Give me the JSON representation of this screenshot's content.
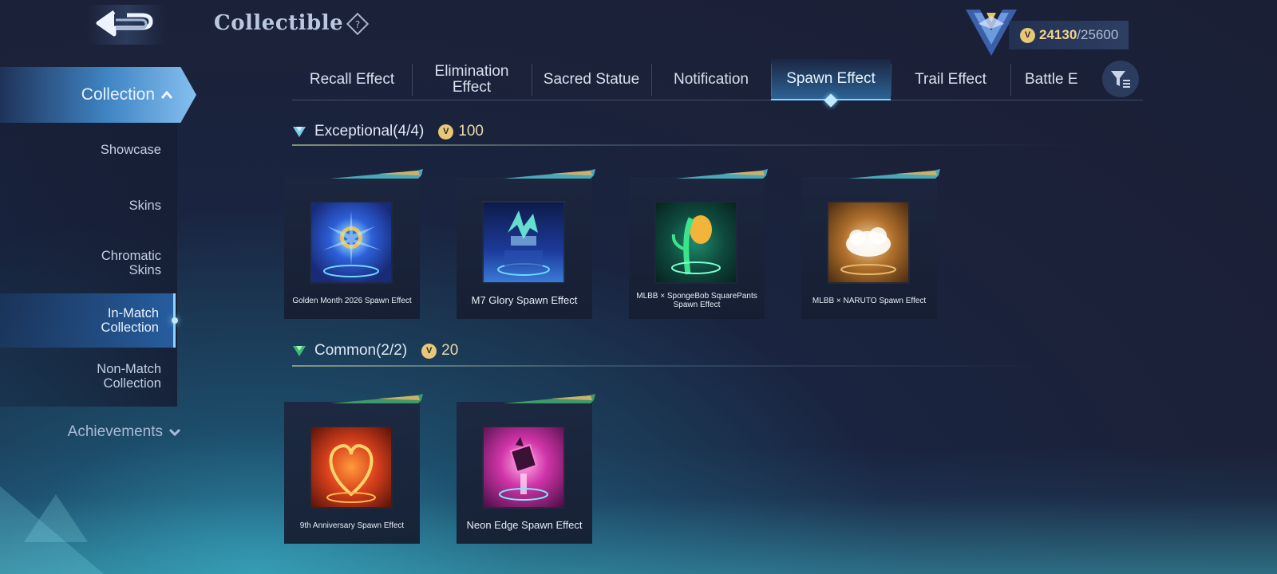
{
  "header": {
    "title": "Collectible",
    "help_icon": "question-diamond-icon",
    "back_icon": "back-arrow-icon",
    "rank_icon": "wing-emblem-icon",
    "points_current": "24130",
    "points_max": "/25600"
  },
  "sidebar": {
    "active_group": "Collection",
    "items": [
      {
        "label": "Showcase"
      },
      {
        "label": "Skins"
      },
      {
        "label": "Chromatic Skins"
      },
      {
        "label": "In-Match Collection",
        "active": true
      },
      {
        "label": "Non-Match Collection"
      }
    ],
    "achievements": "Achievements"
  },
  "tabs": [
    {
      "label": "Recall Effect"
    },
    {
      "label": "Elimination Effect"
    },
    {
      "label": "Sacred Statue"
    },
    {
      "label": "Notification"
    },
    {
      "label": "Spawn Effect",
      "active": true
    },
    {
      "label": "Trail Effect"
    },
    {
      "label": "Battle E"
    }
  ],
  "sections": [
    {
      "title": "Exceptional(4/4)",
      "cost": "100",
      "items": [
        {
          "name": "Golden Month 2026 Spawn Effect"
        },
        {
          "name": "M7 Glory Spawn Effect"
        },
        {
          "name": "MLBB × SpongeBob SquarePants Spawn Effect"
        },
        {
          "name": "MLBB × NARUTO Spawn Effect"
        }
      ]
    },
    {
      "title": "Common(2/2)",
      "cost": "20",
      "items": [
        {
          "name": "9th Anniversary Spawn Effect"
        },
        {
          "name": "Neon Edge Spawn Effect"
        }
      ]
    }
  ],
  "colors": {
    "accent": "#7fd3ff",
    "coin": "#e8c878",
    "background": "#1b2138"
  }
}
